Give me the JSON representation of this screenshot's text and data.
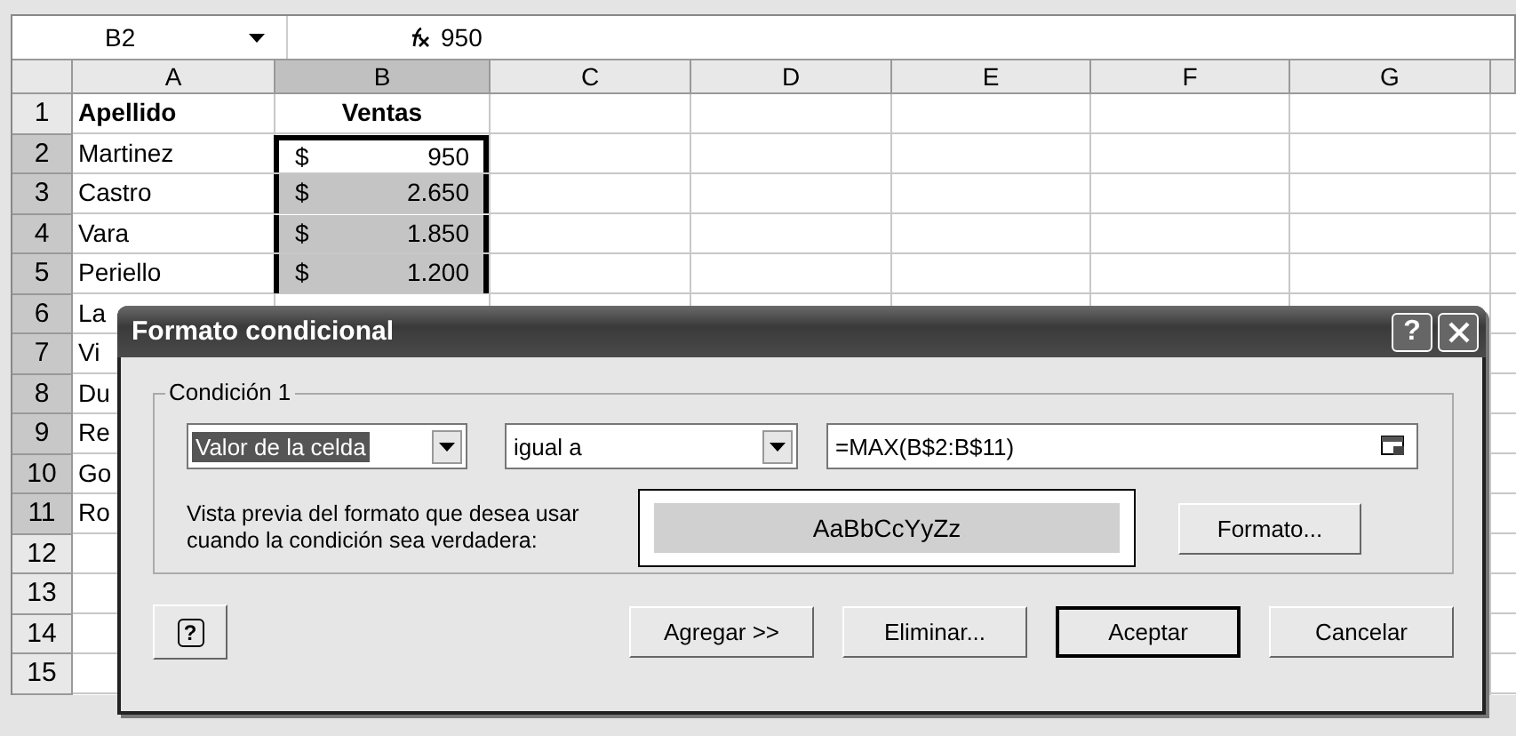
{
  "formula_bar": {
    "name_box": "B2",
    "formula": "950"
  },
  "columns": [
    {
      "label": "A",
      "selected": false
    },
    {
      "label": "B",
      "selected": true
    },
    {
      "label": "C",
      "selected": false
    },
    {
      "label": "D",
      "selected": false
    },
    {
      "label": "E",
      "selected": false
    },
    {
      "label": "F",
      "selected": false
    },
    {
      "label": "G",
      "selected": false
    }
  ],
  "rows": [
    {
      "number": "1",
      "selected": false,
      "cells": [
        {
          "kind": "header",
          "text": "Apellido",
          "selected": false
        },
        {
          "kind": "header",
          "text": "Ventas",
          "selected": false
        }
      ]
    },
    {
      "number": "2",
      "selected": true,
      "cells": [
        {
          "kind": "text",
          "text": "Martinez",
          "selected": false
        },
        {
          "kind": "money",
          "currency": "$",
          "value": "950",
          "selected": true,
          "active": true
        }
      ]
    },
    {
      "number": "3",
      "selected": true,
      "cells": [
        {
          "kind": "text",
          "text": "Castro",
          "selected": false
        },
        {
          "kind": "money",
          "currency": "$",
          "value": "2.650",
          "selected": true,
          "active": false
        }
      ]
    },
    {
      "number": "4",
      "selected": true,
      "cells": [
        {
          "kind": "text",
          "text": "Vara",
          "selected": false
        },
        {
          "kind": "money",
          "currency": "$",
          "value": "1.850",
          "selected": true,
          "active": false
        }
      ]
    },
    {
      "number": "5",
      "selected": true,
      "cells": [
        {
          "kind": "text",
          "text": "Periello",
          "selected": false
        },
        {
          "kind": "money",
          "currency": "$",
          "value": "1.200",
          "selected": true,
          "active": false
        }
      ]
    },
    {
      "number": "6",
      "selected": true,
      "cells": [
        {
          "kind": "text",
          "text": "La",
          "selected": false
        }
      ]
    },
    {
      "number": "7",
      "selected": true,
      "cells": [
        {
          "kind": "text",
          "text": "Vi",
          "selected": false
        }
      ]
    },
    {
      "number": "8",
      "selected": true,
      "cells": [
        {
          "kind": "text",
          "text": "Du",
          "selected": false
        }
      ]
    },
    {
      "number": "9",
      "selected": true,
      "cells": [
        {
          "kind": "text",
          "text": "Re",
          "selected": false
        }
      ]
    },
    {
      "number": "10",
      "selected": true,
      "cells": [
        {
          "kind": "text",
          "text": "Go",
          "selected": false
        }
      ]
    },
    {
      "number": "11",
      "selected": true,
      "cells": [
        {
          "kind": "text",
          "text": "Ro",
          "selected": false
        }
      ]
    },
    {
      "number": "12",
      "selected": false,
      "cells": []
    },
    {
      "number": "13",
      "selected": false,
      "cells": []
    },
    {
      "number": "14",
      "selected": false,
      "cells": []
    },
    {
      "number": "15",
      "selected": false,
      "cells": []
    }
  ],
  "dialog": {
    "title": "Formato condicional",
    "help_button": "?",
    "condition": {
      "legend": "Condición 1",
      "operand": {
        "value": "Valor de la celda",
        "focused": true
      },
      "operator": {
        "value": "igual a",
        "focused": false
      },
      "formula": "=MAX(B$2:B$11)",
      "preview_label": "Vista previa del formato que desea usar cuando la condición sea verdadera:",
      "preview_sample": "AaBbCcYyZz",
      "format_button": "Formato..."
    },
    "help_icon_button": "?",
    "buttons": [
      {
        "label": "Agregar >>",
        "default": false
      },
      {
        "label": "Eliminar...",
        "default": false
      },
      {
        "label": "Aceptar",
        "default": true
      },
      {
        "label": "Cancelar",
        "default": false
      }
    ]
  }
}
